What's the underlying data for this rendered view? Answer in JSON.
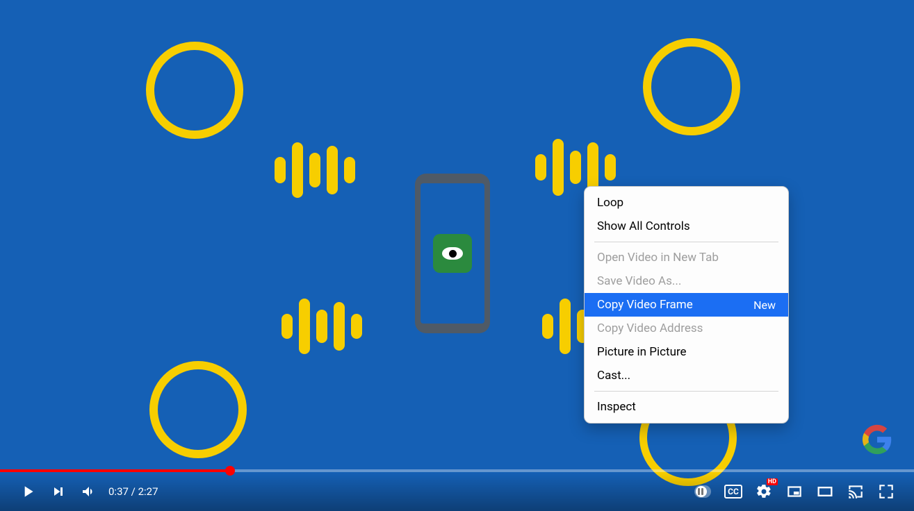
{
  "player": {
    "current_time": "0:37",
    "duration": "2:27",
    "progress_pct": 25.2,
    "hd_badge": "HD",
    "cc_label": "CC"
  },
  "context_menu": {
    "items": [
      {
        "label": "Loop",
        "state": "normal"
      },
      {
        "label": "Show All Controls",
        "state": "normal"
      },
      {
        "sep": true
      },
      {
        "label": "Open Video in New Tab",
        "state": "disabled"
      },
      {
        "label": "Save Video As...",
        "state": "disabled"
      },
      {
        "label": "Copy Video Frame",
        "tag": "New",
        "state": "highlight"
      },
      {
        "label": "Copy Video Address",
        "state": "disabled"
      },
      {
        "label": "Picture in Picture",
        "state": "normal"
      },
      {
        "label": "Cast...",
        "state": "normal"
      },
      {
        "sep": true
      },
      {
        "label": "Inspect",
        "state": "normal"
      }
    ]
  }
}
